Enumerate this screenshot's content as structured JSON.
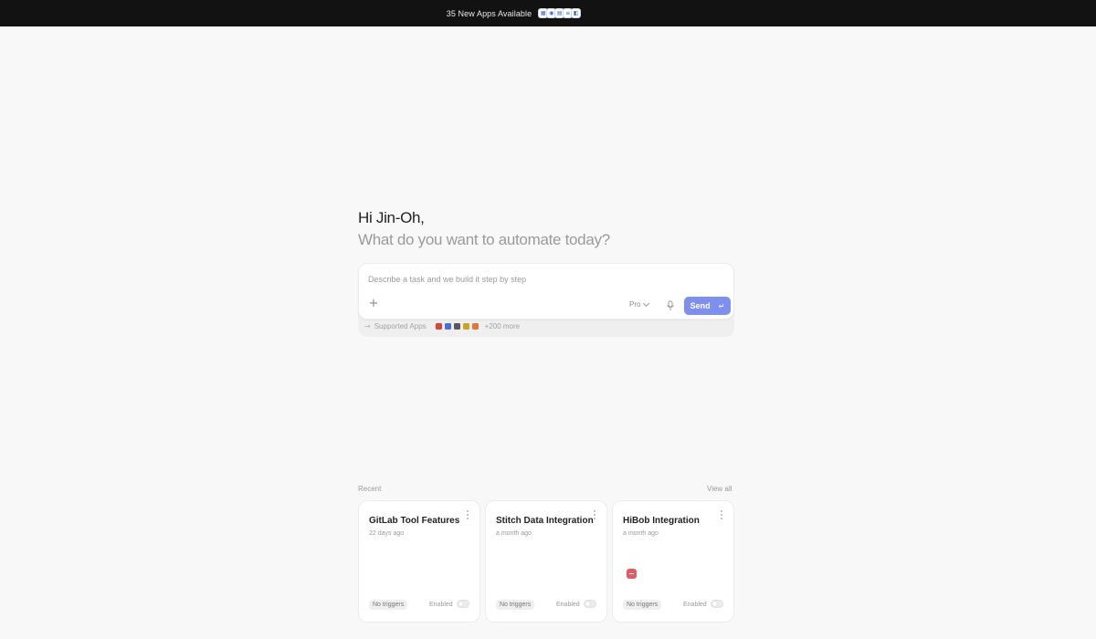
{
  "banner": {
    "text": "35 New Apps Available",
    "icons": [
      "app-icon-1",
      "app-icon-2",
      "app-icon-3",
      "app-icon-4",
      "app-icon-5"
    ]
  },
  "greeting": {
    "title": "Hi Jin-Oh,",
    "subtitle": "What do you want to automate today?"
  },
  "prompt": {
    "placeholder": "Describe a task and we build it step by step",
    "mode": "Pro",
    "send_label": "Send",
    "supported_label": "Supported Apps",
    "more_label": "+200 more",
    "app_icons": [
      "gmail-icon",
      "calendar-icon",
      "docs-icon",
      "slack-icon",
      "zapier-icon"
    ]
  },
  "recent": {
    "label": "Recent",
    "view_all": "View all",
    "cards": [
      {
        "title": "GitLab Tool Features",
        "time": "22 days ago",
        "trigger": "No triggers",
        "enabled_label": "Enabled",
        "enabled": false
      },
      {
        "title": "Stitch Data Integration",
        "time": "a month ago",
        "trigger": "No triggers",
        "enabled_label": "Enabled",
        "enabled": false
      },
      {
        "title": "HiBob Integration",
        "time": "a month ago",
        "trigger": "No triggers",
        "enabled_label": "Enabled",
        "enabled": false
      }
    ]
  },
  "colors": {
    "accent": "#7f8ff0",
    "banner_bg": "#121212",
    "page_bg": "#f8f8f8",
    "hibob_icon": "#e25b62"
  }
}
